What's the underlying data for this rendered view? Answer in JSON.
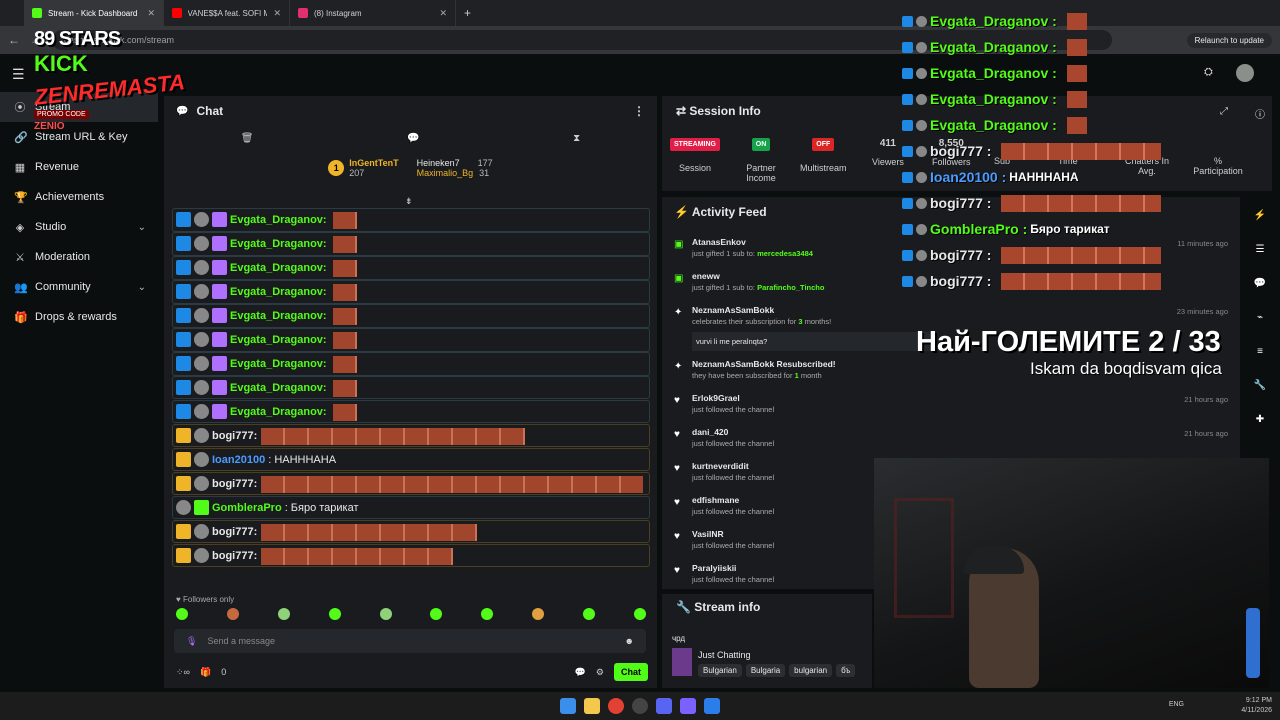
{
  "browser": {
    "tabs": [
      {
        "label": "Stream - Kick Dashboard",
        "color": "#53fc18"
      },
      {
        "label": "VANE$$A feat. SOFI MARIN",
        "color": "#ff0000"
      },
      {
        "label": "(8) Instagram",
        "color": "#e1306c"
      }
    ],
    "url": "dashboard.kick.com/stream",
    "relaunch": "Relaunch to update"
  },
  "logo_overlay": {
    "line1": "89 STARS",
    "line2": "KICK",
    "line3": "ZENREMASTA",
    "line4": "PROMO CODE",
    "line5": "ZENIO"
  },
  "sidebar": {
    "items": [
      {
        "label": "Stream",
        "icon": "stream-icon"
      },
      {
        "label": "Stream URL & Key",
        "icon": "link-icon"
      },
      {
        "label": "Revenue",
        "icon": "chart-icon"
      },
      {
        "label": "Achievements",
        "icon": "trophy-icon"
      },
      {
        "label": "Studio",
        "icon": "layers-icon"
      },
      {
        "label": "Moderation",
        "icon": "sword-icon"
      },
      {
        "label": "Community",
        "icon": "users-icon"
      },
      {
        "label": "Drops & rewards",
        "icon": "gift-icon"
      }
    ]
  },
  "chat": {
    "title": "Chat",
    "gifters": [
      {
        "name": "InGentTenT",
        "count": "207",
        "rank": "1"
      },
      {
        "name": "Heineken7",
        "count": "177"
      },
      {
        "name": "Maximalio_Bg",
        "count": "31"
      }
    ],
    "messages": [
      {
        "user": "Evgata_Draganov:",
        "color": "#53fc18",
        "text": "",
        "emotes": 1
      },
      {
        "user": "Evgata_Draganov:",
        "color": "#53fc18",
        "text": "",
        "emotes": 1
      },
      {
        "user": "Evgata_Draganov:",
        "color": "#53fc18",
        "text": "",
        "emotes": 1
      },
      {
        "user": "Evgata_Draganov:",
        "color": "#53fc18",
        "text": "",
        "emotes": 1
      },
      {
        "user": "Evgata_Draganov:",
        "color": "#53fc18",
        "text": "",
        "emotes": 1
      },
      {
        "user": "Evgata_Draganov:",
        "color": "#53fc18",
        "text": "",
        "emotes": 1
      },
      {
        "user": "Evgata_Draganov:",
        "color": "#53fc18",
        "text": "",
        "emotes": 1
      },
      {
        "user": "Evgata_Draganov:",
        "color": "#53fc18",
        "text": "",
        "emotes": 1
      },
      {
        "user": "Evgata_Draganov:",
        "color": "#53fc18",
        "text": "",
        "emotes": 1
      },
      {
        "user": "bogi777:",
        "color": "#e8e8e8",
        "text": "",
        "emotes": 11
      },
      {
        "user": "Ioan20100",
        "color": "#4a9cff",
        "text": ": НАНННАНА",
        "emotes": 0
      },
      {
        "user": "bogi777:",
        "color": "#e8e8e8",
        "text": "",
        "emotes": 16
      },
      {
        "user": "GombleraPro",
        "color": "#53fc18",
        "text": ": Бяро тарикат",
        "emotes": 0
      },
      {
        "user": "bogi777:",
        "color": "#e8e8e8",
        "text": "",
        "emotes": 9
      },
      {
        "user": "bogi777:",
        "color": "#e8e8e8",
        "text": "",
        "emotes": 8
      }
    ],
    "followers_only": "Followers only",
    "input_placeholder": "Send a message",
    "footer_count": "0",
    "send_label": "Chat"
  },
  "session": {
    "title": "Session Info",
    "streaming": "STREAMING",
    "streaming_label": "Session",
    "partner": "ON",
    "partner_label": "Partner Income",
    "multistream": "OFF",
    "multistream_label": "Multistream",
    "viewers": "411",
    "viewers_label": "Viewers",
    "followers": "8,550",
    "followers_label": "Followers",
    "subs_label": "Sub",
    "time_label": "Time",
    "chatters_label": "Chatters In Avg.",
    "participation_label": "% Participation"
  },
  "activity": {
    "title": "Activity Feed",
    "items": [
      {
        "name": "AtanasEnkov",
        "pre": "just gifted 1 sub to:",
        "target": "mercedesa3484",
        "time": "11 minutes ago",
        "icon": "gift-icon"
      },
      {
        "name": "eneww",
        "pre": "just gifted 1 sub to:",
        "target": "Parafincho_Tincho",
        "time": "",
        "icon": "gift-icon"
      },
      {
        "name": "NeznamAsSamBokk",
        "pre": "celebrates their subscription for",
        "target": "3",
        "post": "months!",
        "quote": "vurvi li me peralnqta?",
        "time": "23 minutes ago",
        "icon": "star-icon"
      },
      {
        "name": "NeznamAsSamBokk Resubscribed!",
        "pre": "they have been subscribed for",
        "target": "1",
        "post": "month",
        "time": "",
        "icon": "star-icon"
      },
      {
        "name": "Erlok9Grael",
        "pre": "just followed the channel",
        "time": "21 hours ago",
        "icon": "heart-icon"
      },
      {
        "name": "dani_420",
        "pre": "just followed the channel",
        "time": "21 hours ago",
        "icon": "heart-icon"
      },
      {
        "name": "kurtneverdidit",
        "pre": "just followed the channel",
        "time": "",
        "icon": "heart-icon"
      },
      {
        "name": "edfishmane",
        "pre": "just followed the channel",
        "time": "",
        "icon": "heart-icon"
      },
      {
        "name": "VasilNR",
        "pre": "just followed the channel",
        "time": "",
        "icon": "heart-icon"
      },
      {
        "name": "Paralyiiskii",
        "pre": "just followed the channel",
        "time": "",
        "icon": "heart-icon"
      }
    ]
  },
  "streaminfo": {
    "title": "Stream info",
    "heading": "чрд",
    "category": "Just Chatting",
    "tags": [
      "Bulgarian",
      "Bulgaria",
      "bulgarian",
      "бъ"
    ]
  },
  "overlay": {
    "lines": [
      {
        "user": "Evgata_Draganov :",
        "color": "#53fc18",
        "text": ""
      },
      {
        "user": "Evgata_Draganov :",
        "color": "#53fc18",
        "text": ""
      },
      {
        "user": "Evgata_Draganov :",
        "color": "#53fc18",
        "text": ""
      },
      {
        "user": "Evgata_Draganov :",
        "color": "#53fc18",
        "text": ""
      },
      {
        "user": "Evgata_Draganov :",
        "color": "#53fc18",
        "text": ""
      },
      {
        "user": "bogi777 :",
        "color": "#e8e8e8",
        "text": ""
      },
      {
        "user": "Ioan20100 :",
        "color": "#4a9cff",
        "text": "НАНННАНА"
      },
      {
        "user": "bogi777 :",
        "color": "#e8e8e8",
        "text": ""
      },
      {
        "user": "GombleraPro :",
        "color": "#53fc18",
        "text": "Бяро тарикат"
      },
      {
        "user": "bogi777 :",
        "color": "#e8e8e8",
        "text": ""
      },
      {
        "user": "bogi777 :",
        "color": "#e8e8e8",
        "text": ""
      }
    ],
    "title": "Най-ГОЛЕМИТЕ 2 / 33",
    "subtitle": "Iskam da boqdisvam qica"
  },
  "taskbar": {
    "lang": "ENG",
    "time": "9:12 PM",
    "date": "4/11/2026"
  }
}
